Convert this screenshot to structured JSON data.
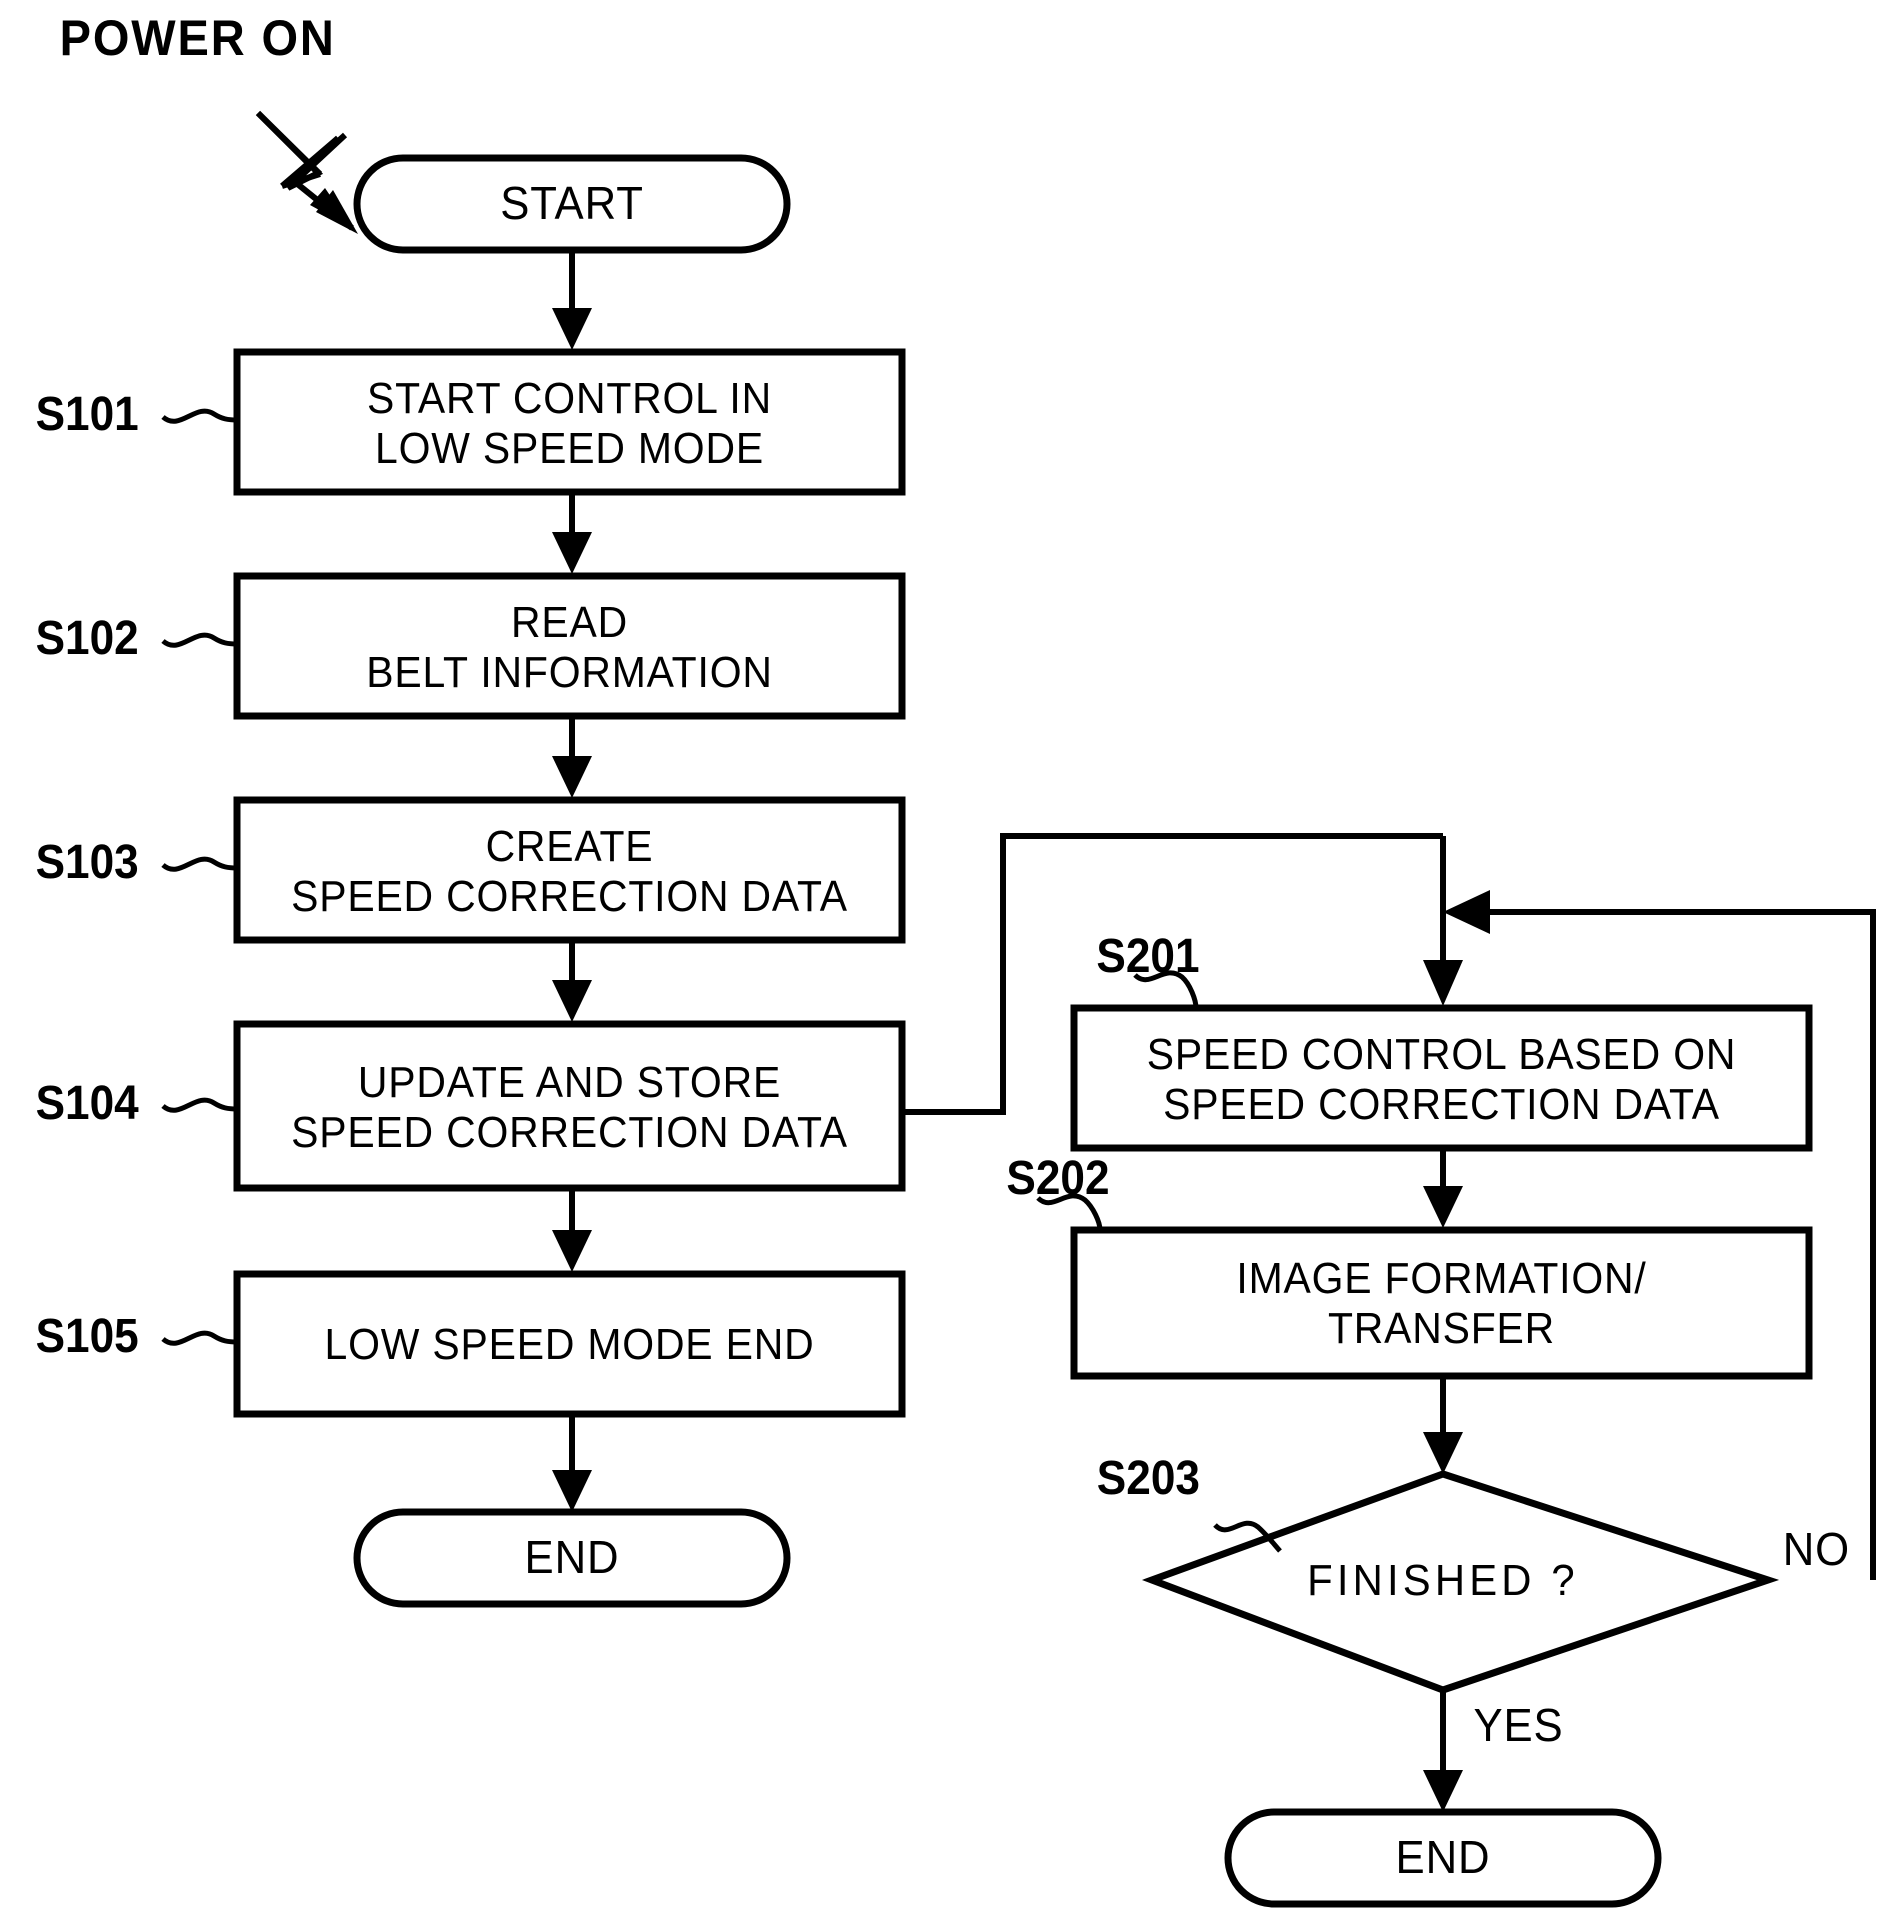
{
  "diagram": {
    "type": "flowchart",
    "title_annotation": "POWER ON",
    "left_branch": {
      "start_terminal": "START",
      "end_terminal": "END",
      "steps": [
        {
          "id": "S101",
          "text_line1": "START CONTROL IN",
          "text_line2": "LOW SPEED MODE"
        },
        {
          "id": "S102",
          "text_line1": "READ",
          "text_line2": "BELT INFORMATION"
        },
        {
          "id": "S103",
          "text_line1": "CREATE",
          "text_line2": "SPEED CORRECTION DATA"
        },
        {
          "id": "S104",
          "text_line1": "UPDATE AND STORE",
          "text_line2": "SPEED CORRECTION DATA"
        },
        {
          "id": "S105",
          "text_line1": "LOW SPEED MODE END",
          "text_line2": ""
        }
      ]
    },
    "right_branch": {
      "end_terminal": "END",
      "steps": [
        {
          "id": "S201",
          "text_line1": "SPEED CONTROL BASED ON",
          "text_line2": "SPEED CORRECTION DATA"
        },
        {
          "id": "S202",
          "text_line1": "IMAGE FORMATION/",
          "text_line2": "TRANSFER"
        }
      ],
      "decision": {
        "id": "S203",
        "text": "FINISHED ?",
        "yes_label": "YES",
        "no_label": "NO"
      }
    },
    "colors": {
      "stroke": "#000000",
      "fill": "#ffffff",
      "text": "#000000"
    }
  }
}
